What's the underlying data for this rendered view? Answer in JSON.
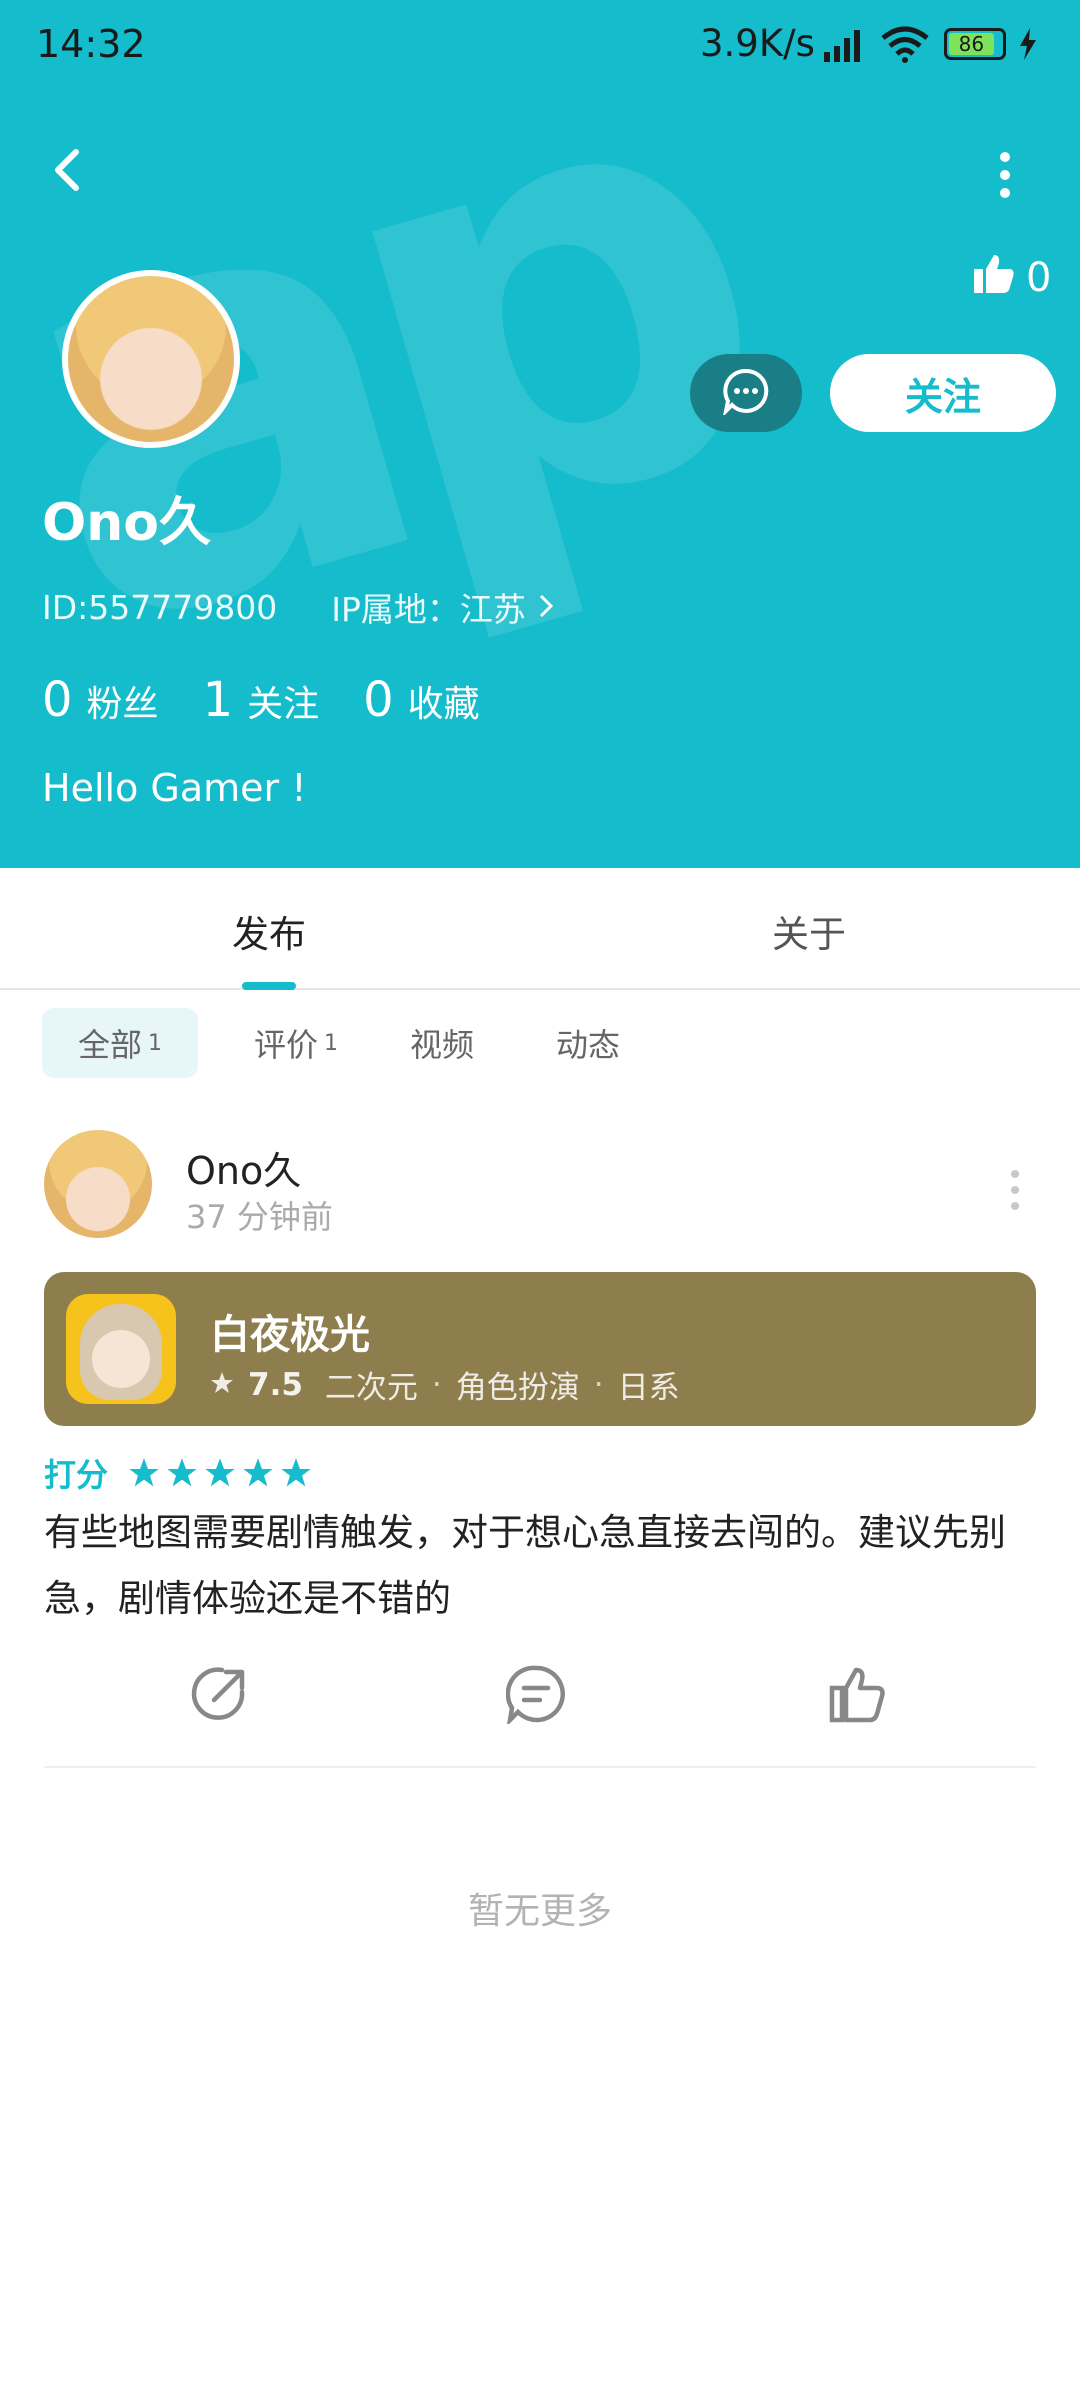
{
  "status_bar": {
    "time": "14:32",
    "network_speed": "3.9K/s",
    "battery": "86"
  },
  "profile": {
    "likes": "0",
    "name": "Ono久",
    "id_text": "ID:557779800",
    "ip_text": "IP属地：江苏",
    "follow_label": "关注",
    "stats": [
      {
        "num": "0",
        "label": "粉丝"
      },
      {
        "num": "1",
        "label": "关注"
      },
      {
        "num": "0",
        "label": "收藏"
      }
    ],
    "bio": "Hello Gamer !"
  },
  "tabs": [
    {
      "label": "发布"
    },
    {
      "label": "关于"
    }
  ],
  "chips": [
    {
      "label": "全部",
      "count": "1"
    },
    {
      "label": "评价",
      "count": "1"
    },
    {
      "label": "视频"
    },
    {
      "label": "动态"
    }
  ],
  "post": {
    "author": "Ono久",
    "time": "37 分钟前",
    "game": {
      "title": "白夜极光",
      "score": "7.5",
      "tags": [
        "二次元",
        "角色扮演",
        "日系"
      ]
    },
    "rating_label": "打分",
    "stars": 5,
    "content": "有些地图需要剧情触发，对于想心急直接去闯的。建议先别急，剧情体验还是不错的"
  },
  "footer": {
    "no_more": "暂无更多"
  },
  "colors": {
    "accent": "#14bccc",
    "header_bg": "#14bccc",
    "game_card_bg": "#8e7d4d"
  }
}
